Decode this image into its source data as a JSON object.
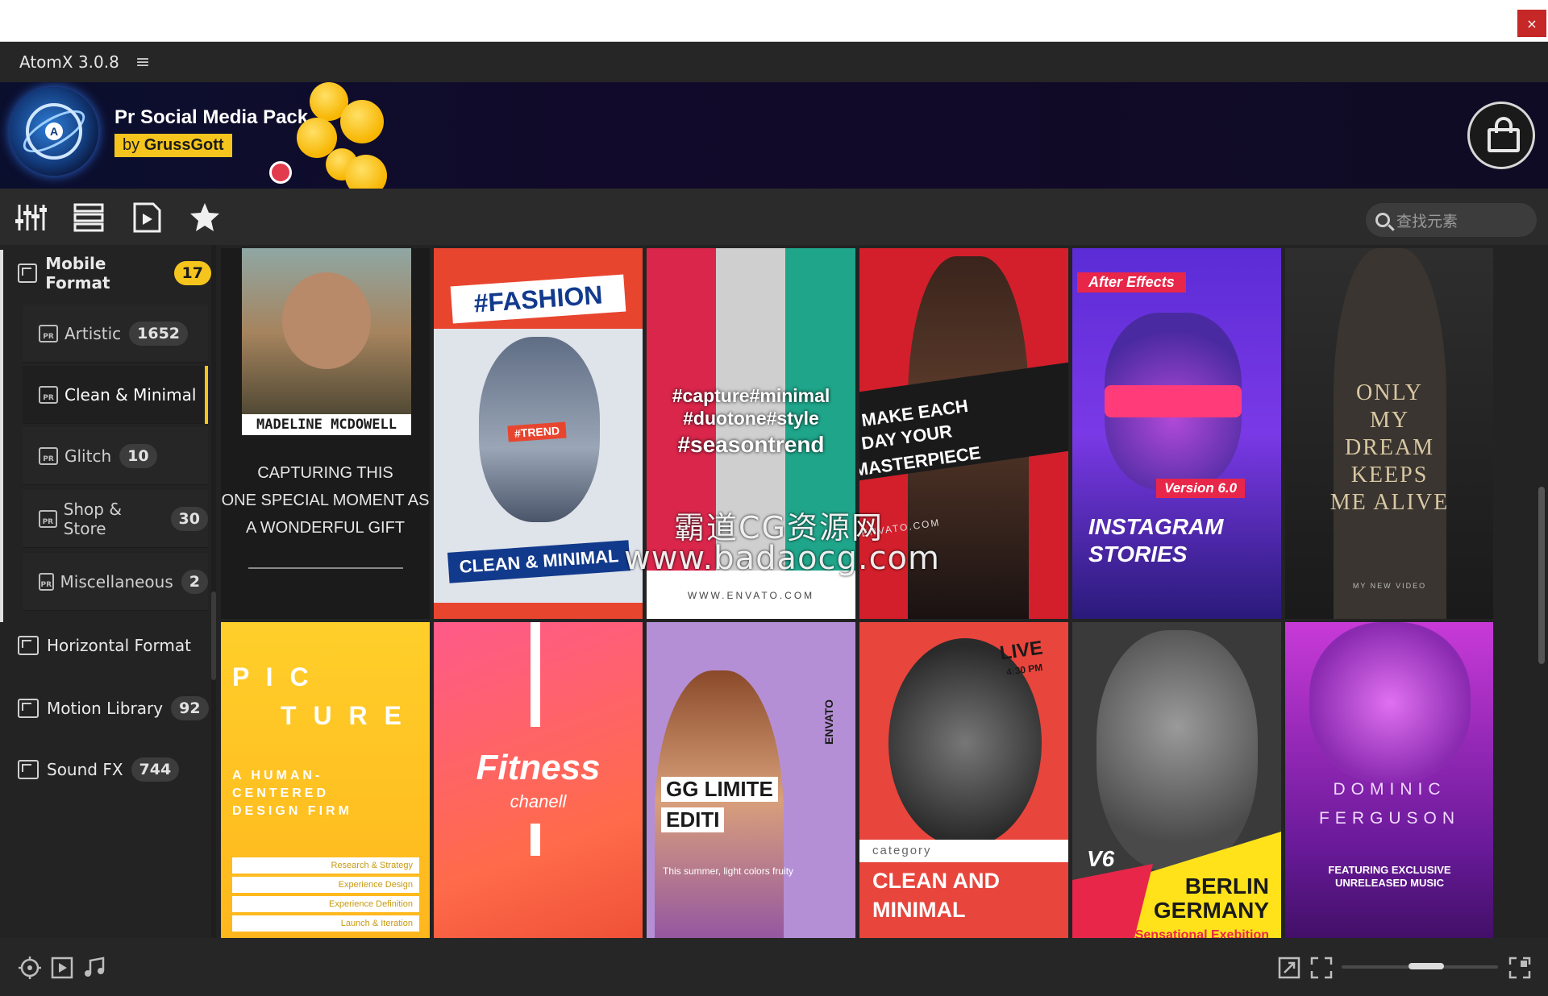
{
  "window": {
    "close_glyph": "×"
  },
  "app": {
    "title": "AtomX 3.0.8",
    "menu_glyph": "≡"
  },
  "banner": {
    "pack_title": "Pr Social Media Pack",
    "author_prefix": "by ",
    "author_name": "GrussGott",
    "logo_letter": "A"
  },
  "toolbar": {
    "icons": [
      "mixer-icon",
      "list-icon",
      "media-file-icon",
      "star-icon"
    ],
    "search_placeholder": "查找元素"
  },
  "sidebar": {
    "categories": [
      {
        "label": "Mobile Format",
        "count": "17",
        "expanded": true
      },
      {
        "label": "Horizontal Format",
        "count": ""
      },
      {
        "label": "Motion Library",
        "count": "92"
      },
      {
        "label": "Sound FX",
        "count": "744"
      }
    ],
    "subcategories": [
      {
        "label": "Artistic",
        "count": "1652"
      },
      {
        "label": "Clean & Minimal",
        "count": "",
        "active": true
      },
      {
        "label": "Glitch",
        "count": "10"
      },
      {
        "label": "Shop & Store",
        "count": "30"
      },
      {
        "label": "Miscellaneous",
        "count": "2"
      }
    ],
    "pr_tag": "PR"
  },
  "tiles": {
    "t1": {
      "name": "MADELINE  MCDOWELL",
      "line1": "CAPTURING THIS",
      "line2": "ONE SPECIAL MOMENT AS",
      "line3": "A WONDERFUL GIFT"
    },
    "t2": {
      "tag": "#FASHION",
      "badge": "#TREND",
      "footer": "CLEAN & MINIMAL"
    },
    "t3": {
      "line1": "#capture#minimal",
      "line2": "#duotone#style",
      "line3": "#seasontrend",
      "url": "WWW.ENVATO.COM"
    },
    "t4": {
      "line1": "MAKE EACH",
      "line2": "DAY YOUR",
      "line3": "MASTERPIECE",
      "url": "ENVATO.COM"
    },
    "t5": {
      "top": "After Effects",
      "version": "Version 6.0",
      "line1": "INSTAGRAM",
      "line2": "STORIES"
    },
    "t6": {
      "line1": "ONLY",
      "line2": "MY",
      "line3": "DREAM",
      "line4": "KEEPS",
      "line5": "ME ALIVE",
      "footer": "MY NEW VIDEO"
    },
    "t7": {
      "line1": "P I C",
      "line2": "T U R E",
      "sub1": "A HUMAN-",
      "sub2": "CENTERED",
      "sub3": "DESIGN FIRM",
      "items": [
        "Research & Strategy",
        "Experience Design",
        "Experience Definition",
        "Launch & Iteration"
      ]
    },
    "t8": {
      "title": "Fitness",
      "sub": "chanell"
    },
    "t9": {
      "side": "ENVATO",
      "line1": "GG LIMITE",
      "line2": "EDITI",
      "caption": "This summer, light colors fruity"
    },
    "t10": {
      "live": "LIVE",
      "time": "4:30 PM",
      "category": "category",
      "line1": "CLEAN AND",
      "line2": "MINIMAL"
    },
    "t11": {
      "v": "V6",
      "line1": "BERLIN",
      "line2": "GERMANY",
      "footer": "Sensational Exebition"
    },
    "t12": {
      "line1": "DOMINIC",
      "line2": "FERGUSON",
      "sub1": "FEATURING EXCLUSIVE",
      "sub2": "UNRELEASED MUSIC"
    }
  },
  "watermark": {
    "line1": "霸道CG资源网",
    "line2": "www.badaocg.com"
  },
  "statusbar": {
    "left_icons": [
      "target-icon",
      "play-icon",
      "music-note-icon"
    ],
    "right_icons": [
      "expand-icon",
      "fullscreen-icon",
      "grid-size-icon"
    ],
    "zoom_level": 0.55
  },
  "colors": {
    "accent": "#f5c51e",
    "background": "#232323",
    "close": "#c62828"
  }
}
